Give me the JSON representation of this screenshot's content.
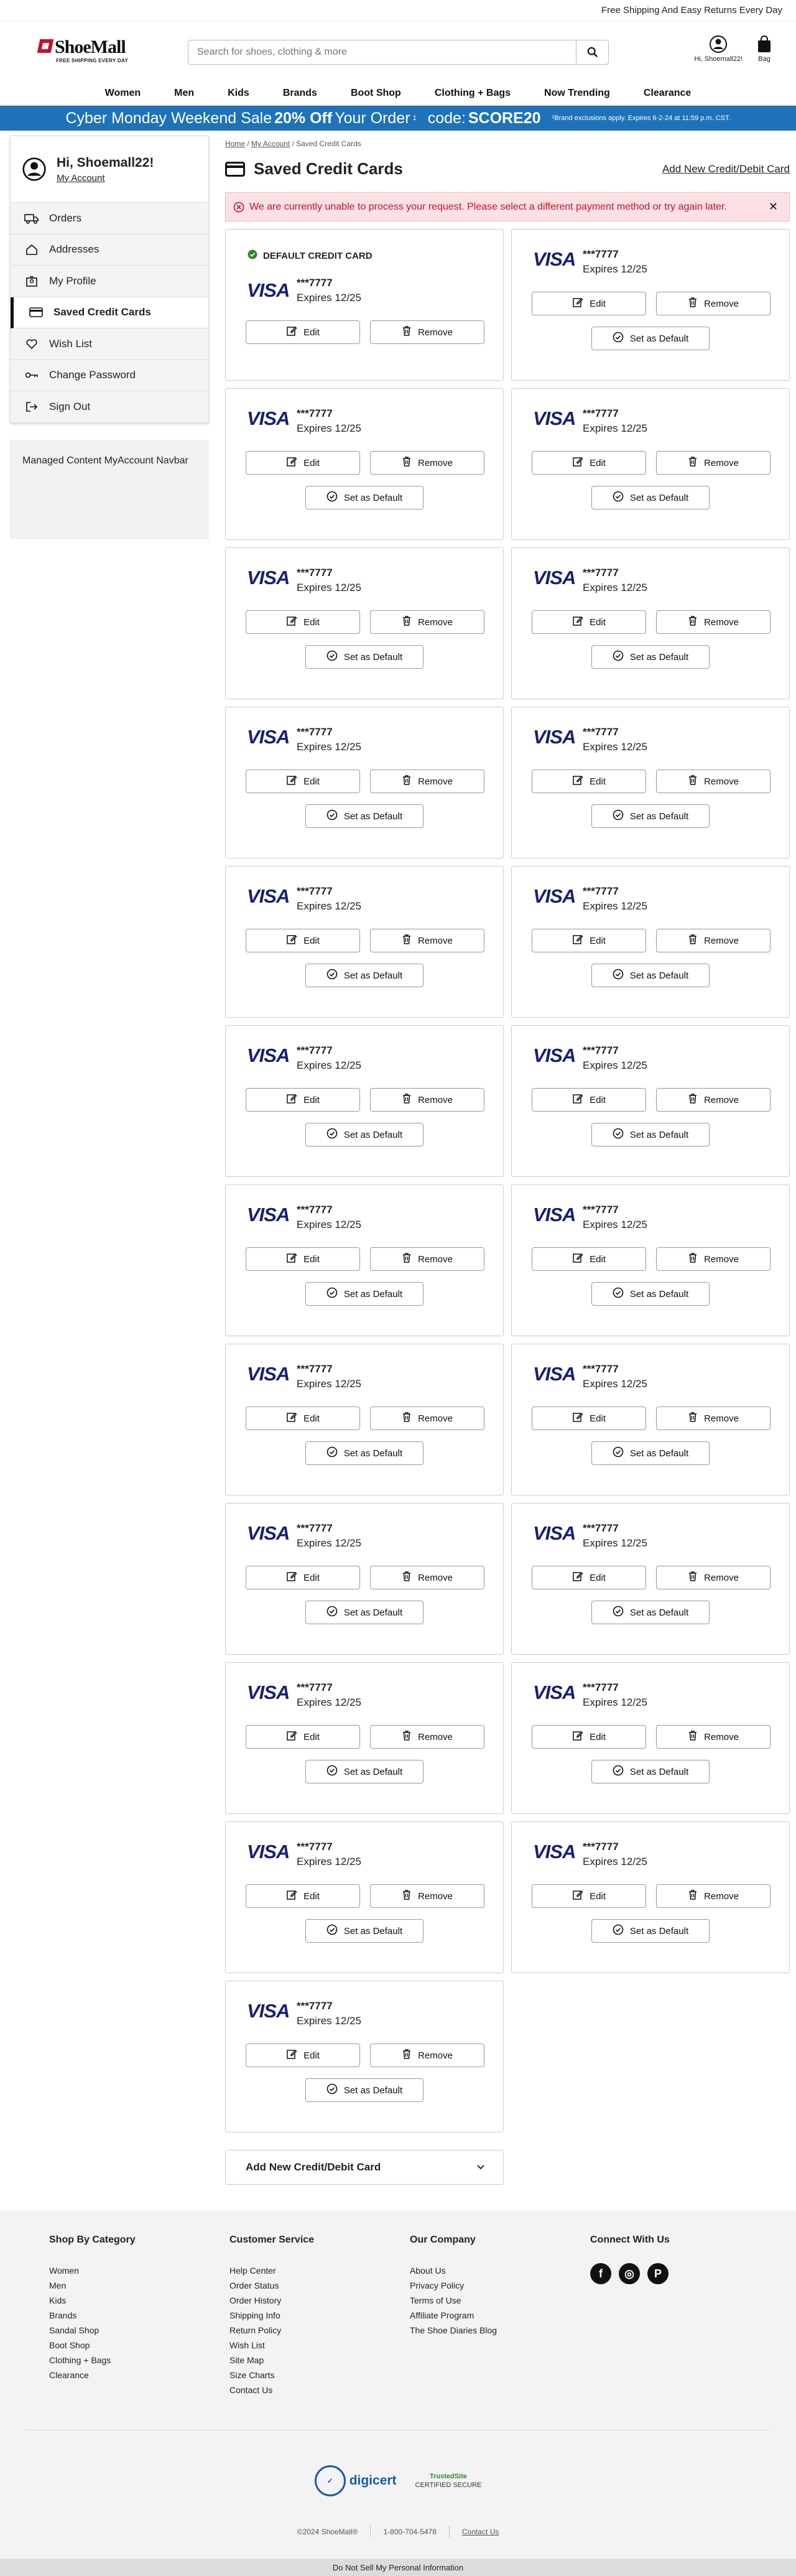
{
  "topbar": {
    "text": "Free Shipping And Easy Returns Every Day"
  },
  "logo": {
    "name": "ShoeMall",
    "tagline": "FREE SHIPPING EVERY DAY"
  },
  "search": {
    "placeholder": "Search for shoes, clothing & more"
  },
  "header_icons": {
    "account_label": "Hi, Shoemall22!",
    "bag_label": "Bag"
  },
  "nav": [
    "Women",
    "Men",
    "Kids",
    "Brands",
    "Boot Shop",
    "Clothing + Bags",
    "Now Trending",
    "Clearance"
  ],
  "promo": {
    "lead": "Cyber Monday Weekend Sale",
    "off": "20% Off",
    "order": "Your Order",
    "sup": "1",
    "code_label": "code:",
    "code": "SCORE20",
    "fine": "¹Brand exclusions apply. Expires 6-2-24 at 11:59 p.m. CST."
  },
  "account": {
    "greeting": "Hi, Shoemall22!",
    "my_account": "My Account",
    "items": [
      {
        "label": "Orders",
        "icon": "truck-icon"
      },
      {
        "label": "Addresses",
        "icon": "home-icon"
      },
      {
        "label": "My Profile",
        "icon": "profile-icon"
      },
      {
        "label": "Saved Credit Cards",
        "icon": "credit-card-icon"
      },
      {
        "label": "Wish List",
        "icon": "heart-icon"
      },
      {
        "label": "Change Password",
        "icon": "key-icon"
      },
      {
        "label": "Sign Out",
        "icon": "sign-out-icon"
      }
    ],
    "active_index": 3,
    "managed": "Managed Content MyAccount Navbar"
  },
  "breadcrumb": {
    "home": "Home",
    "account": "My Account",
    "current": "Saved Credit Cards"
  },
  "page": {
    "title": "Saved Credit Cards",
    "add_link": "Add New Credit/Debit Card",
    "error": "We are currently unable to process your request. Please select a different payment method or try again later."
  },
  "cards": {
    "default_label": "DEFAULT CREDIT CARD",
    "brand": "VISA",
    "number": "***7777",
    "expires": "Expires 12/25",
    "edit": "Edit",
    "remove": "Remove",
    "set_default": "Set as Default",
    "count": 23
  },
  "add_new": {
    "label": "Add New Credit/Debit Card"
  },
  "footer": {
    "shop": {
      "title": "Shop By Category",
      "items": [
        "Women",
        "Men",
        "Kids",
        "Brands",
        "Sandal Shop",
        "Boot Shop",
        "Clothing + Bags",
        "Clearance"
      ]
    },
    "service": {
      "title": "Customer Service",
      "items": [
        "Help Center",
        "Order Status",
        "Order History",
        "Shipping Info",
        "Return Policy",
        "Wish List",
        "Site Map",
        "Size Charts",
        "Contact Us"
      ]
    },
    "company": {
      "title": "Our Company",
      "items": [
        "About Us",
        "Privacy Policy",
        "Terms of Use",
        "Affiliate Program",
        "The Shoe Diaries Blog"
      ]
    },
    "connect": {
      "title": "Connect With Us"
    },
    "badges": {
      "digicert": "digicert",
      "trusted": "TrustedSite",
      "trusted_sub": "CERTIFIED SECURE"
    },
    "copyright": "©2024 ShoeMall®",
    "phone": "1-800-704-5478",
    "contact": "Contact Us",
    "donot": "Do Not Sell My Personal Information"
  },
  "colors": {
    "promo": "#1e72b8",
    "error": "#c8102e",
    "visa": "#1a1f71",
    "check": "#2a8a2a"
  }
}
